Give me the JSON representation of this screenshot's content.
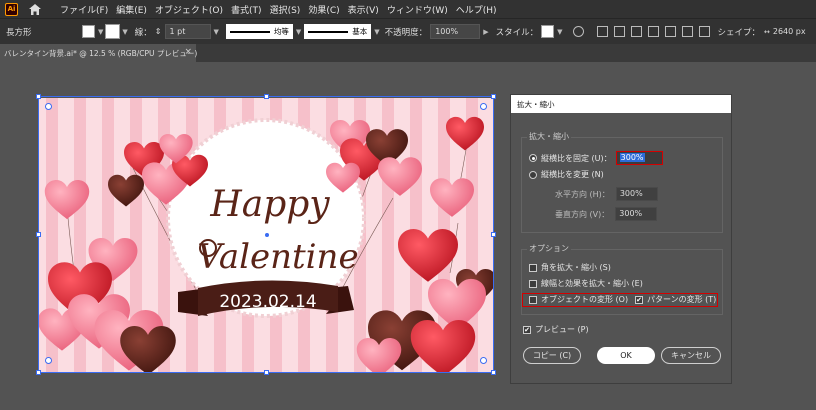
{
  "app": {
    "logo": "Ai"
  },
  "menus": [
    "ファイル(F)",
    "編集(E)",
    "オブジェクト(O)",
    "書式(T)",
    "選択(S)",
    "効果(C)",
    "表示(V)",
    "ウィンドウ(W)",
    "ヘルプ(H)"
  ],
  "control_bar": {
    "object_type": "長方形",
    "stroke_label": "線：",
    "stroke_value": "1 pt",
    "profile_label": "均等",
    "brush_label": "基本",
    "opacity_label": "不透明度：",
    "opacity_value": "100%",
    "style_label": "スタイル：",
    "shape_label": "シェイプ：",
    "shape_value": "2640 px"
  },
  "document_tab": {
    "title": "バレンタイン背景.ai* @ 12.5 % (RGB/CPU プレビュー)",
    "close": "×"
  },
  "artwork": {
    "title_line1": "Happy",
    "title_line2": "Valentine",
    "date": "2023.02.14",
    "stripe_light": "#fbdde2",
    "stripe_dark": "#f6c0ca",
    "text_color": "#5a2417",
    "ribbon_color": "#4a1d16"
  },
  "dialog": {
    "title": "拡大・縮小",
    "scale_group": "拡大・縮小",
    "uniform_label": "縦横比を固定 (U)：",
    "uniform_value": "300%",
    "nonuniform_label": "縦横比を変更 (N)",
    "horizontal_label": "水平方向 (H)：",
    "horizontal_value": "300%",
    "vertical_label": "垂直方向 (V)：",
    "vertical_value": "300%",
    "options_group": "オプション",
    "scale_corners": "角を拡大・縮小 (S)",
    "scale_strokes": "線幅と効果を拡大・縮小 (E)",
    "transform_objects": "オブジェクトの変形 (O)",
    "transform_patterns": "パターンの変形 (T)",
    "preview": "プレビュー (P)",
    "copy_button": "コピー (C)",
    "ok_button": "OK",
    "cancel_button": "キャンセル",
    "check_mark": "✔"
  }
}
